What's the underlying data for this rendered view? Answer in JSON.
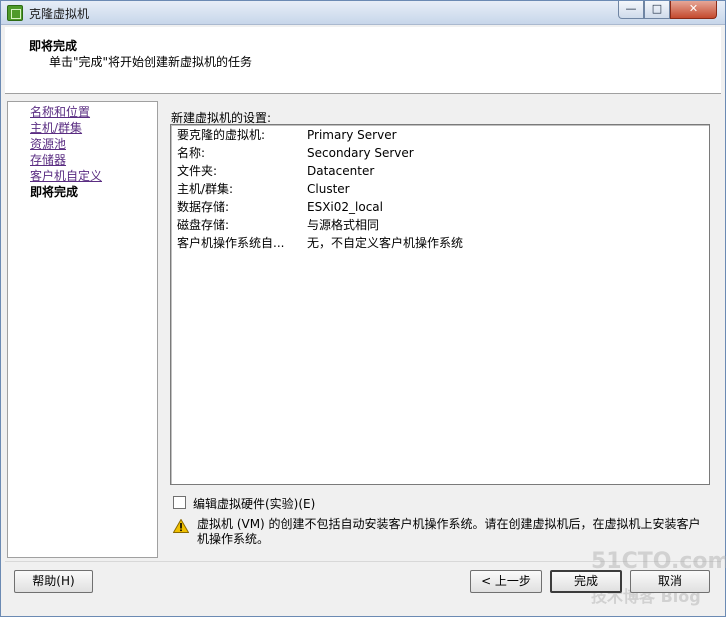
{
  "window": {
    "title": "克隆虚拟机",
    "min_glyph": "—",
    "max_glyph": "□",
    "close_glyph": "✕"
  },
  "header": {
    "title": "即将完成",
    "description": "单击\"完成\"将开始创建新虚拟机的任务"
  },
  "nav": {
    "items": [
      {
        "label": "名称和位置"
      },
      {
        "label": "主机/群集"
      },
      {
        "label": "资源池"
      },
      {
        "label": "存储器"
      },
      {
        "label": "客户机自定义"
      },
      {
        "label": "即将完成"
      }
    ]
  },
  "main": {
    "section_label": "新建虚拟机的设置:",
    "settings": [
      {
        "key": "要克隆的虚拟机:",
        "value": "Primary Server"
      },
      {
        "key": "名称:",
        "value": "Secondary Server"
      },
      {
        "key": "文件夹:",
        "value": "Datacenter"
      },
      {
        "key": "主机/群集:",
        "value": "Cluster"
      },
      {
        "key": "数据存储:",
        "value": "ESXi02_local"
      },
      {
        "key": "磁盘存储:",
        "value": "与源格式相同"
      },
      {
        "key": "客户机操作系统自...",
        "value": "无，不自定义客户机操作系统"
      }
    ],
    "edit_hardware_label": "编辑虚拟硬件(实验)(E)",
    "edit_hardware_checked": false,
    "warning_text": "虚拟机 (VM) 的创建不包括自动安装客户机操作系统。请在创建虚拟机后，在虚拟机上安装客户机操作系统。"
  },
  "footer": {
    "help_label": "帮助(H)",
    "back_label": "< 上一步",
    "finish_label": "完成",
    "cancel_label": "取消"
  },
  "watermark": {
    "line1": "51CTO.com",
    "line2": "技术博客  Blog"
  },
  "colors": {
    "visited_link": "#5a2d82",
    "titlebar": "#c7d6ea",
    "warning": "#f0c000"
  }
}
